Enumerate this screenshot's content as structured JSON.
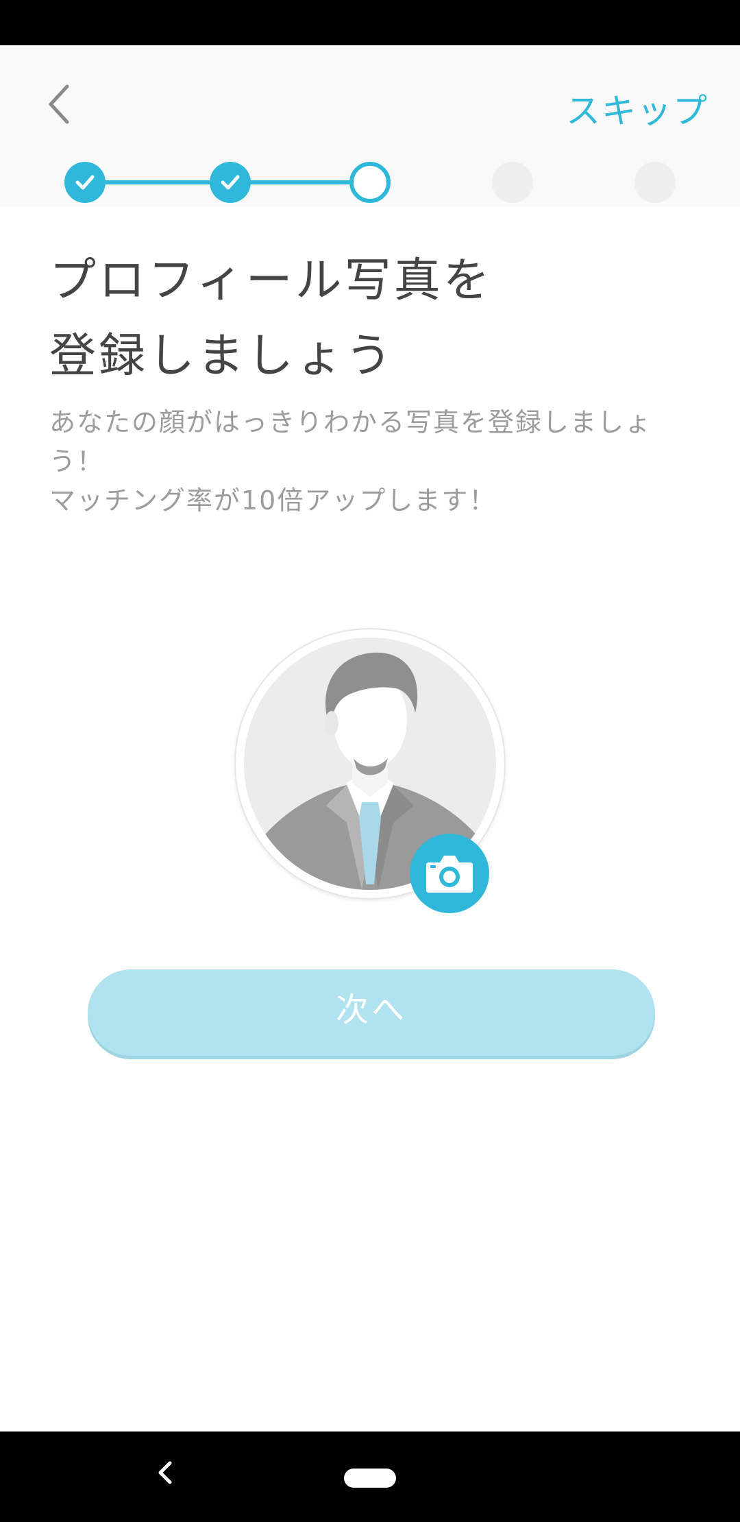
{
  "header": {
    "skip_label": "スキップ"
  },
  "stepper": {
    "total_steps": 5,
    "current_step": 3,
    "completed_steps": 2
  },
  "main": {
    "title_line1": "プロフィール写真を",
    "title_line2": "登録しましょう",
    "desc_line1": "あなたの顔がはっきりわかる写真を登録しましょ",
    "desc_line2": "う！",
    "desc_line3": "マッチング率が10倍アップします！",
    "next_button_label": "次へ"
  },
  "icons": {
    "back": "chevron-left-icon",
    "camera": "camera-icon",
    "avatar": "person-placeholder-icon"
  },
  "colors": {
    "accent": "#2fb8d9",
    "button_disabled": "#b0e3ef",
    "title_text": "#444444",
    "desc_text": "#9c9c9c"
  }
}
